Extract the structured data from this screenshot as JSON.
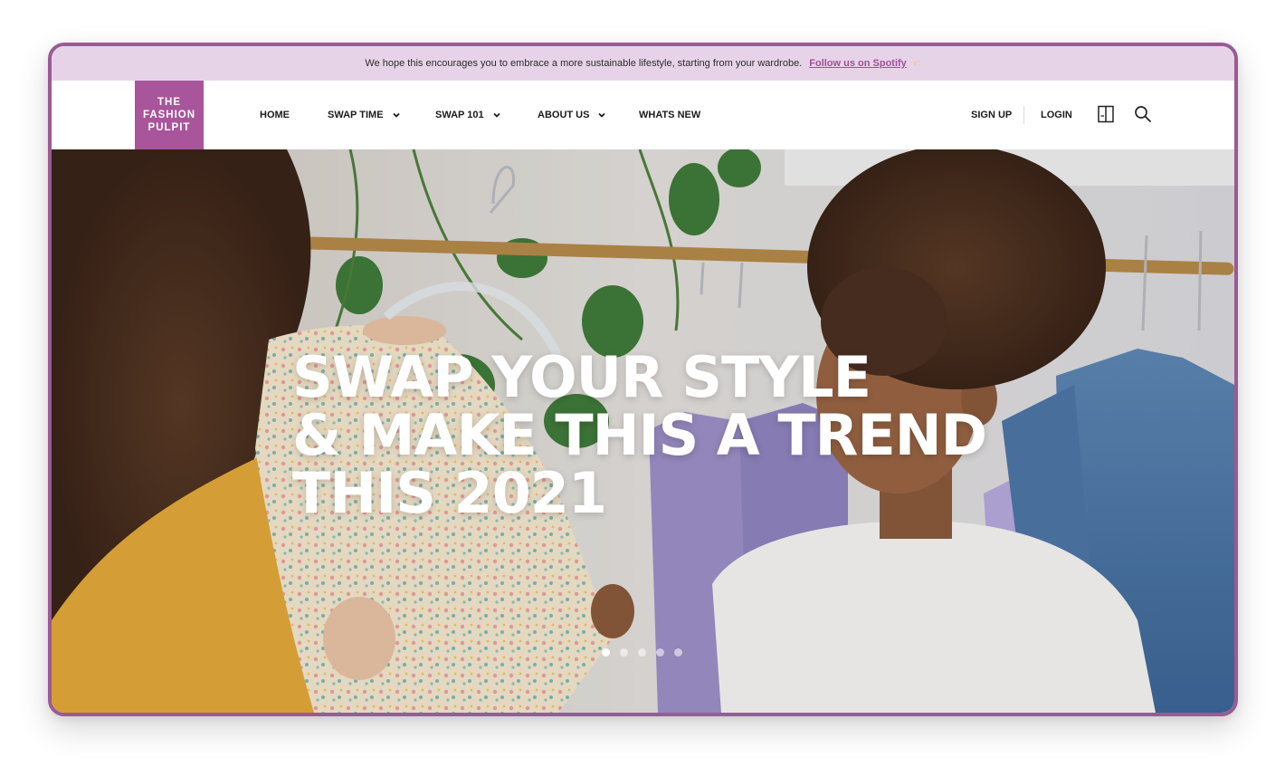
{
  "announcement": {
    "message": "We hope this encourages you to embrace a more sustainable lifestyle, starting from your wardrobe.",
    "link_label": "Follow us on Spotify",
    "link_color": "#a0509b",
    "background": "#e7d3e8",
    "icon": "pointing-hand-icon"
  },
  "logo": {
    "line1": "THE",
    "line2": "FASHION",
    "line3": "PULPIT",
    "color": "#a8559b"
  },
  "nav": {
    "items": [
      {
        "label": "HOME",
        "has_dropdown": false
      },
      {
        "label": "SWAP TIME",
        "has_dropdown": true
      },
      {
        "label": "SWAP 101",
        "has_dropdown": true
      },
      {
        "label": "ABOUT US",
        "has_dropdown": true
      },
      {
        "label": "WHATS NEW",
        "has_dropdown": false
      }
    ],
    "sign_up": "SIGN UP",
    "login": "LOGIN",
    "icons": [
      "book-icon",
      "search-icon"
    ]
  },
  "hero": {
    "headline_line1": "SWAP YOUR STYLE",
    "headline_line2": "& MAKE THIS A TREND",
    "headline_line3": "THIS 2021",
    "slide_count": 5,
    "active_slide": 1
  },
  "frame_color": "#9b5a94"
}
